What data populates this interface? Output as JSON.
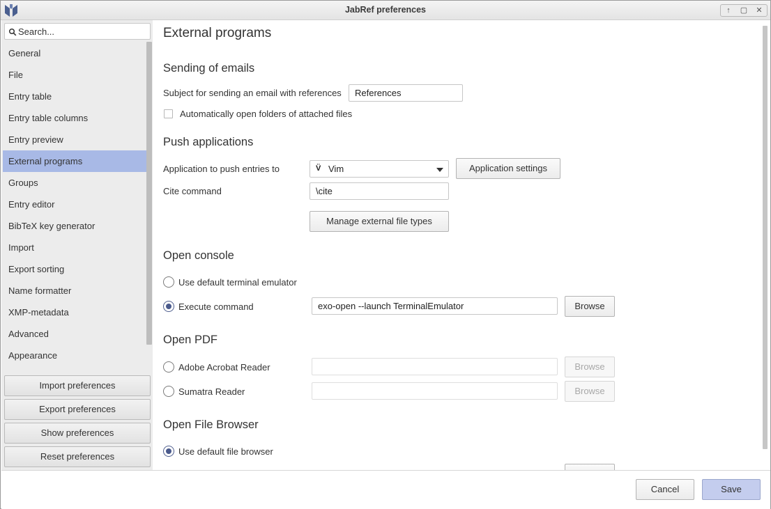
{
  "window": {
    "title": "JabRef preferences",
    "controls": [
      "↑",
      "▢",
      "✕"
    ]
  },
  "sidebar": {
    "search_placeholder": "Search...",
    "items": [
      {
        "label": "General"
      },
      {
        "label": "File"
      },
      {
        "label": "Entry table"
      },
      {
        "label": "Entry table columns"
      },
      {
        "label": "Entry preview"
      },
      {
        "label": "External programs",
        "active": true
      },
      {
        "label": "Groups"
      },
      {
        "label": "Entry editor"
      },
      {
        "label": "BibTeX key generator"
      },
      {
        "label": "Import"
      },
      {
        "label": "Export sorting"
      },
      {
        "label": "Name formatter"
      },
      {
        "label": "XMP-metadata"
      },
      {
        "label": "Advanced"
      },
      {
        "label": "Appearance"
      }
    ],
    "buttons": {
      "import": "Import preferences",
      "export": "Export preferences",
      "show": "Show preferences",
      "reset": "Reset preferences"
    }
  },
  "main": {
    "title": "External programs",
    "emails": {
      "heading": "Sending of emails",
      "subject_label": "Subject for sending an email with references",
      "subject_value": "References",
      "auto_open_label": "Automatically open folders of attached files",
      "auto_open_checked": false
    },
    "push": {
      "heading": "Push applications",
      "app_label": "Application to push entries to",
      "app_value": "Vim",
      "app_icon_glyph": "V̈",
      "app_settings_label": "Application settings",
      "cite_label": "Cite command",
      "cite_value": "\\cite",
      "manage_label": "Manage external file types"
    },
    "console": {
      "heading": "Open console",
      "default_label": "Use default terminal emulator",
      "default_checked": false,
      "execute_label": "Execute command",
      "execute_checked": true,
      "command_value": "exo-open --launch TerminalEmulator",
      "browse_label": "Browse"
    },
    "pdf": {
      "heading": "Open PDF",
      "acrobat_label": "Adobe Acrobat Reader",
      "acrobat_value": "",
      "sumatra_label": "Sumatra Reader",
      "sumatra_value": "",
      "browse_label": "Browse"
    },
    "file_browser": {
      "heading": "Open File Browser",
      "default_label": "Use default file browser",
      "default_checked": true
    }
  },
  "footer": {
    "cancel_label": "Cancel",
    "save_label": "Save"
  },
  "colors": {
    "active_item": "#a8b9e6",
    "primary_button": "#c4cdee",
    "sidebar_bg": "#ececec"
  }
}
